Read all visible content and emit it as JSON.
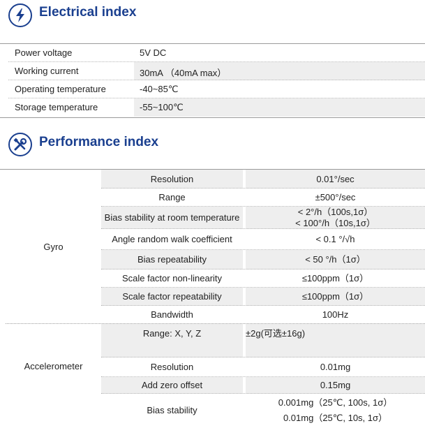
{
  "electrical": {
    "title": "Electrical index",
    "icon": "lightning-icon",
    "rows": [
      {
        "label": "Power voltage",
        "value": "5V DC"
      },
      {
        "label": "Working current",
        "value": "30mA （40mA max）"
      },
      {
        "label": "Operating temperature",
        "value": "-40~85℃"
      },
      {
        "label": "Storage temperature",
        "value": "-55~100℃"
      }
    ]
  },
  "performance": {
    "title": "Performance index",
    "icon": "tools-icon",
    "groups": [
      {
        "name": "Gyro",
        "rows": [
          {
            "param": "Resolution",
            "values": [
              "0.01°/sec"
            ]
          },
          {
            "param": "Range",
            "values": [
              "±500°/sec"
            ]
          },
          {
            "param": "Bias stability at room temperature",
            "values": [
              "< 2°/h（100s,1σ）",
              "< 100°/h（10s,1σ）"
            ]
          },
          {
            "param": "Angle random walk coefficient",
            "values": [
              "< 0.1 °/√h"
            ]
          },
          {
            "param": "Bias repeatability",
            "values": [
              "< 50 °/h（1σ）"
            ]
          },
          {
            "param": "Scale factor non-linearity",
            "values": [
              "≤100ppm（1σ）"
            ]
          },
          {
            "param": "Scale factor repeatability",
            "values": [
              "≤100ppm（1σ）"
            ]
          },
          {
            "param": "Bandwidth",
            "values": [
              "100Hz"
            ]
          }
        ]
      },
      {
        "name": "Accelerometer",
        "rows": [
          {
            "param": "Range: X, Y, Z",
            "values": [
              "±2g(可选±16g)"
            ]
          },
          {
            "param": "Resolution",
            "values": [
              "0.01mg"
            ]
          },
          {
            "param": "Add zero offset",
            "values": [
              "0.15mg"
            ]
          },
          {
            "param": "Bias stability",
            "values": [
              "0.001mg（25℃, 100s, 1σ）",
              "0.01mg（25℃, 10s, 1σ）"
            ]
          }
        ]
      }
    ]
  }
}
